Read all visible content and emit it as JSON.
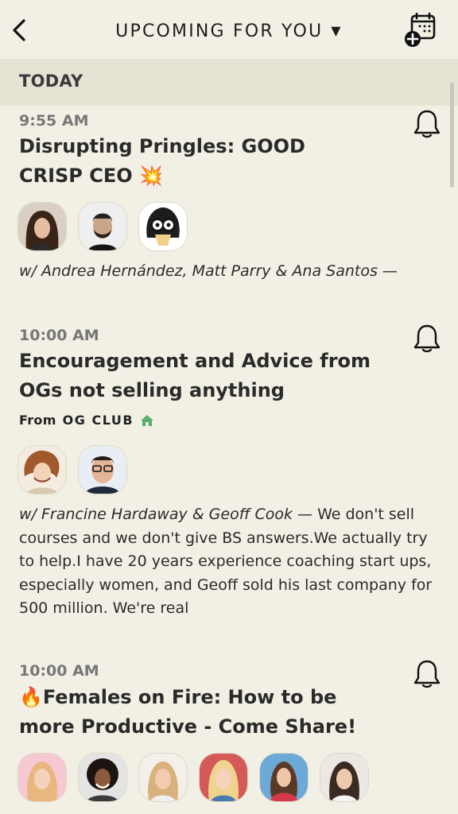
{
  "header": {
    "title": "UPCOMING FOR YOU",
    "caret": "▼"
  },
  "section": {
    "label": "TODAY"
  },
  "events": [
    {
      "time": "9:55 AM",
      "title": "Disrupting Pringles: GOOD CRISP CEO 💥",
      "speakers": "w/ Andrea Hernández, Matt Parry & Ana Santos",
      "description": " —",
      "avatars": [
        "woman-avatar",
        "bearded-man-avatar",
        "cartoon-girl-avatar"
      ]
    },
    {
      "time": "10:00 AM",
      "title": "Encouragement and Advice from OGs not selling anything",
      "club_prefix": "From",
      "club_name": "OG CLUB",
      "speakers": "w/ Francine Hardaway & Geoff Cook",
      "description": " — We don't sell courses and we don't give BS answers.We actually try to help.I have 20 years experience coaching start ups, especially women, and Geoff sold his last company for 500 million. We're real",
      "avatars": [
        "caricature-woman-avatar",
        "man-glasses-avatar"
      ]
    },
    {
      "time": "10:00 AM",
      "title": "🔥Females on Fire: How to be more Productive - Come Share!",
      "avatars": [
        "woman-1-avatar",
        "woman-2-avatar",
        "woman-3-avatar",
        "woman-4-avatar",
        "woman-5-avatar",
        "woman-6-avatar"
      ]
    }
  ],
  "colors": {
    "background": "#F2F0E4",
    "section_band": "#E6E3D5",
    "club_house": "#58B06C"
  }
}
